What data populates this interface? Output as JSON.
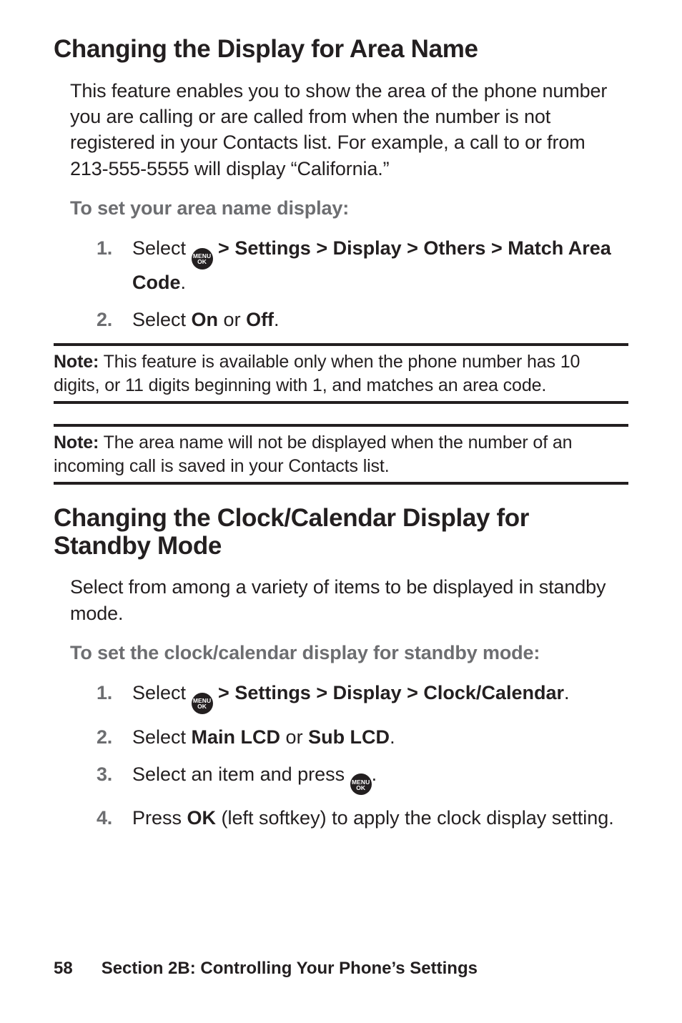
{
  "icons": {
    "menu_ok_top": "MENU",
    "menu_ok_bottom": "OK"
  },
  "section1": {
    "title": "Changing the Display for Area Name",
    "intro": "This feature enables you to show the area of the phone number you are calling or are called from when the number is not registered in your Contacts list. For example, a call to or from 213-555-5555 will display “California.”",
    "subheading": "To set your area name display:",
    "steps": [
      {
        "num": "1.",
        "pre": "Select ",
        "post": " > Settings > Display > Others > Match Area Code",
        "tail": "."
      },
      {
        "num": "2.",
        "pre": "Select ",
        "bold1": "On",
        "mid": " or ",
        "bold2": "Off",
        "tail": "."
      }
    ]
  },
  "note1": {
    "label": "Note:",
    "text": " This feature is available only when the phone number has 10 digits, or 11 digits beginning with 1, and matches an area code."
  },
  "note2": {
    "label": "Note:",
    "text": " The area name will not be displayed when the number of an incoming call is saved in your Contacts list."
  },
  "section2": {
    "title": "Changing the Clock/Calendar Display for Standby Mode",
    "intro": "Select from among a variety of items to be displayed in standby mode.",
    "subheading": "To set the clock/calendar display for standby mode:",
    "steps": {
      "s1": {
        "num": "1.",
        "pre": "Select ",
        "post": " > Settings > Display > Clock/Calendar",
        "tail": "."
      },
      "s2": {
        "num": "2.",
        "pre": "Select ",
        "bold1": "Main LCD",
        "mid": " or ",
        "bold2": "Sub LCD",
        "tail": "."
      },
      "s3": {
        "num": "3.",
        "pre": "Select an item and press ",
        "tail": "."
      },
      "s4": {
        "num": "4.",
        "pre": "Press ",
        "bold1": "OK",
        "post": " (left softkey) to apply the clock display setting."
      }
    }
  },
  "footer": {
    "page": "58",
    "label": "Section 2B: Controlling Your Phone’s Settings"
  }
}
